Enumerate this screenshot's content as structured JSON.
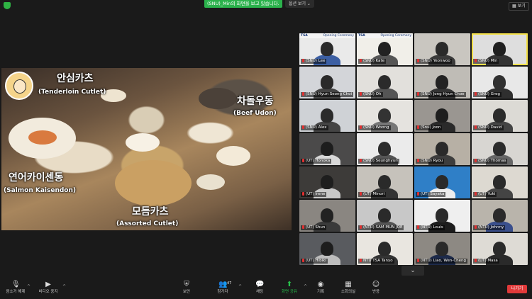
{
  "top": {
    "share_banner": "(SNU)_Min의 화면을 보고 있습니다.",
    "view_options": "옵션 보기",
    "view_button": "보기"
  },
  "shared_screen": {
    "labels": [
      {
        "kr": "안심카츠",
        "en": "(Tenderloin Cutlet)"
      },
      {
        "kr": "차돌우동",
        "en": "(Beef Udon)"
      },
      {
        "kr": "연어카이센동",
        "en": "(Salmon Kaisendon)"
      },
      {
        "kr": "모듬카츠",
        "en": "(Assorted Cutlet)"
      }
    ]
  },
  "participants": [
    {
      "name": "(SNU) Lee",
      "slide": "TSA",
      "slide2": "Opening Ceremony"
    },
    {
      "name": "(SNU) Kate",
      "slide": "TSA",
      "slide2": "Opening Ceremony"
    },
    {
      "name": "(SNU) Yeonwoo"
    },
    {
      "name": "(SNU) Min"
    },
    {
      "name": "(SNU) Hyun Seong Choi"
    },
    {
      "name": "(SNU) Oh"
    },
    {
      "name": "(SNU) Jong Hyun Choe"
    },
    {
      "name": "(SNU) Greg"
    },
    {
      "name": "(SNU) Alex"
    },
    {
      "name": "(SNU) Woong"
    },
    {
      "name": "(Snu) Joon"
    },
    {
      "name": "(SNU) David"
    },
    {
      "name": "(UT) Honoka"
    },
    {
      "name": "(SNU) Seunghyun"
    },
    {
      "name": "(SNU) Ryou"
    },
    {
      "name": "(SNU) Thomas"
    },
    {
      "name": "(UT) Irene"
    },
    {
      "name": "(UT) Minori"
    },
    {
      "name": "(UT) Sayaka"
    },
    {
      "name": "(UT) Yuki"
    },
    {
      "name": "(UT) Shun"
    },
    {
      "name": "(NTU) SAM MUN JOE"
    },
    {
      "name": "(NTU) Louis"
    },
    {
      "name": "(NTU) Johnny"
    },
    {
      "name": "(UT) Hibiki"
    },
    {
      "name": "NTU TSA Tanyo"
    },
    {
      "name": "(NTU) Liao, Wen-Cheng"
    },
    {
      "name": "(UT) Masa"
    }
  ],
  "toolbar": {
    "unmute": "음소거 해제",
    "video": "비디오 중지",
    "security": "보안",
    "participants": "참가자",
    "participants_count": "47",
    "chat": "채팅",
    "share": "화면 공유",
    "record": "기록",
    "breakout": "소회의실",
    "reactions": "반응",
    "leave": "나가기"
  },
  "colors": {
    "share_green": "#2bb24c",
    "leave_red": "#e03a3a",
    "active_speaker": "#f3e04a"
  }
}
